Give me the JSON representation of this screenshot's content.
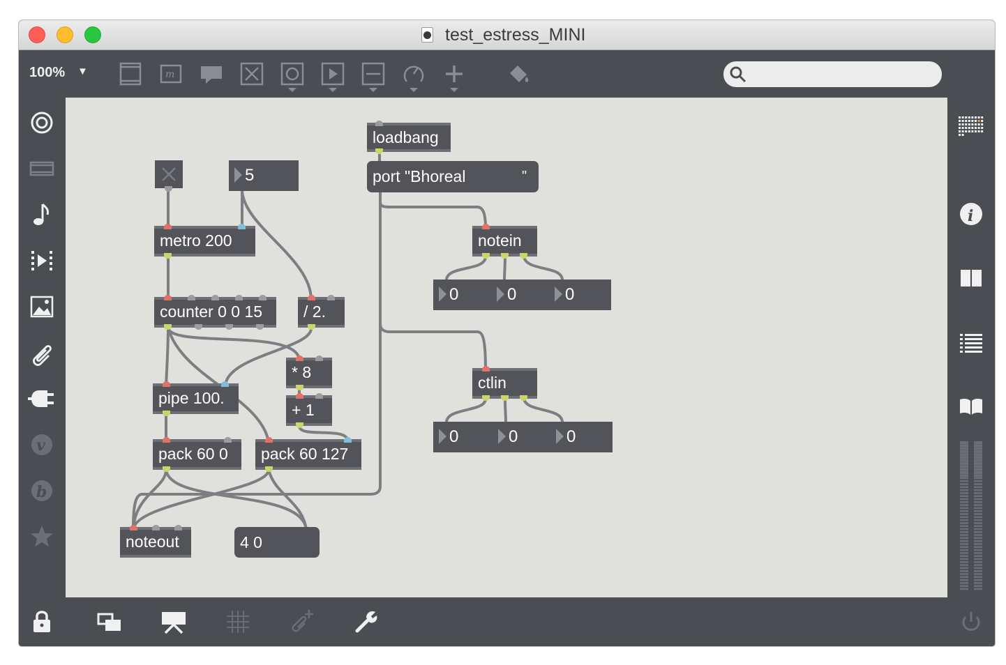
{
  "window": {
    "title": "test_estress_MINI"
  },
  "toolbar": {
    "zoom": "100%",
    "zoom_caret": "▼",
    "search": {
      "value": "",
      "placeholder": ""
    },
    "icons": [
      "patcher-view-icon",
      "message-box-icon",
      "comment-icon",
      "toggle-object-icon",
      "button-object-icon",
      "presentation-icon",
      "slider-icon",
      "dial-icon",
      "add-object-icon",
      "paint-bucket-icon"
    ]
  },
  "sidebar_left": [
    "target-icon",
    "media-icon",
    "music-note-icon",
    "playlist-icon",
    "image-icon",
    "paperclip-icon",
    "plug-icon",
    "vst-icon",
    "bpatcher-icon",
    "favorites-star-icon"
  ],
  "sidebar_right": [
    "grid-dots-icon",
    "info-icon",
    "reference-book-icon",
    "list-icon",
    "open-book-icon",
    "level-meter"
  ],
  "bottombar": [
    "lock-icon",
    "new-view-icon",
    "presentation-mode-icon",
    "grid-icon",
    "snap-attach-icon",
    "wrench-icon",
    "power-icon"
  ],
  "patch": {
    "toggle": {
      "state": false
    },
    "objects": {
      "loadbang": "loadbang",
      "metro": "metro 200",
      "counter": "counter 0 0 15",
      "divide": "/ 2.",
      "multiply": "* 8",
      "plus": "+ 1",
      "pipe": "pipe 100.",
      "pack1": "pack 60 0",
      "pack2": "pack 60 127",
      "notein": "notein",
      "ctlin": "ctlin",
      "noteout": "noteout"
    },
    "messages": {
      "port": "port \"Bhoreal",
      "port_suffix": "\"",
      "list": "4 0"
    },
    "numbers": {
      "metro_rate": "5",
      "notein_out": [
        "0",
        "0",
        "0"
      ],
      "ctlin_out": [
        "0",
        "0",
        "0"
      ]
    }
  }
}
